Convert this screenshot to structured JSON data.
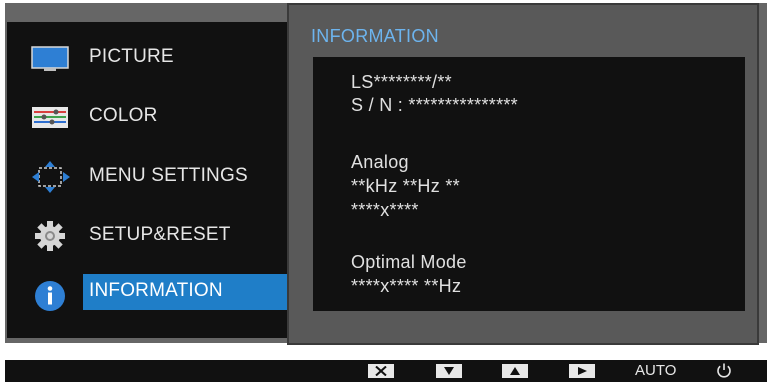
{
  "menu": {
    "items": [
      {
        "label": "PICTURE",
        "icon": "monitor-icon"
      },
      {
        "label": "COLOR",
        "icon": "color-sliders-icon"
      },
      {
        "label": "MENU SETTINGS",
        "icon": "menu-settings-arrows-icon"
      },
      {
        "label": "SETUP&RESET",
        "icon": "gear-icon"
      },
      {
        "label": "INFORMATION",
        "icon": "info-icon",
        "selected": true
      }
    ]
  },
  "info": {
    "title": "INFORMATION",
    "lines": [
      "LS********/**",
      "S / N : ***************",
      "Analog",
      "**kHz **Hz **",
      "****x****",
      "Optimal Mode",
      "****x**** **Hz"
    ]
  },
  "buttons": {
    "close_icon": "close-icon",
    "down_icon": "down-arrow-icon",
    "up_icon": "up-arrow-icon",
    "right_icon": "right-arrow-icon",
    "auto_label": "AUTO",
    "power_icon": "power-icon"
  },
  "colors": {
    "accent": "#1f7ec8",
    "title": "#6db4ee",
    "panel_dark": "#111111",
    "panel_gray": "#595959"
  }
}
